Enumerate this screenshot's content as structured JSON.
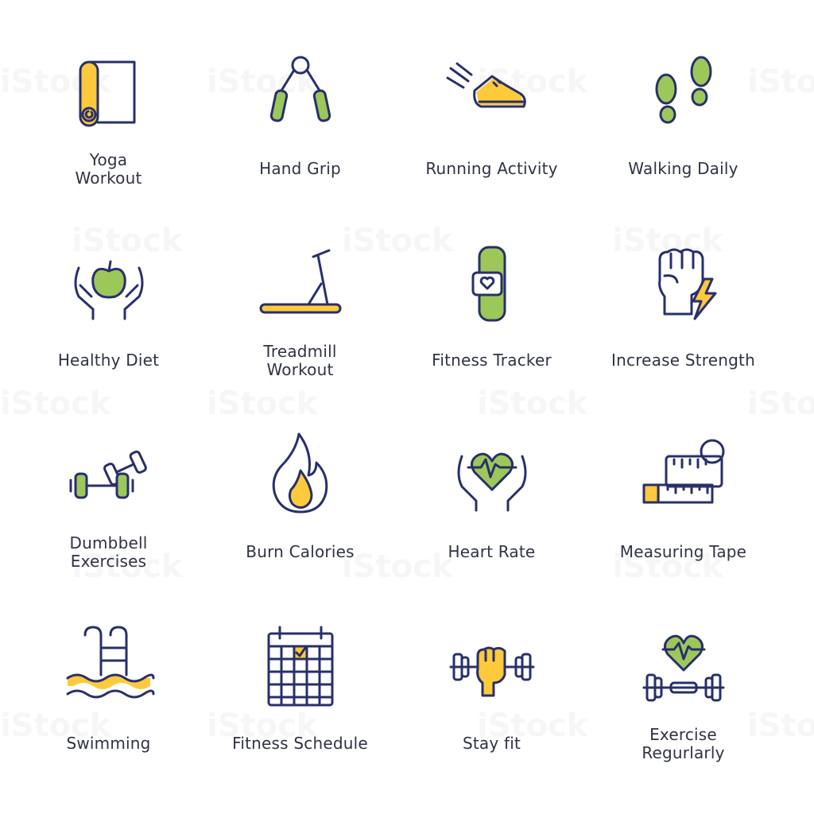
{
  "colors": {
    "stroke": "#27306b",
    "yellow": "#ffc93c",
    "green": "#9cc85a",
    "text": "#2f3344"
  },
  "watermark": "iStock",
  "icons": [
    {
      "label": "Yoga\nWorkout",
      "icon": "yoga-mat-icon"
    },
    {
      "label": "Hand Grip",
      "icon": "hand-grip-icon"
    },
    {
      "label": "Running Activity",
      "icon": "running-shoe-icon"
    },
    {
      "label": "Walking Daily",
      "icon": "footprints-icon"
    },
    {
      "label": "Healthy Diet",
      "icon": "hands-apple-icon"
    },
    {
      "label": "Treadmill\nWorkout",
      "icon": "treadmill-icon"
    },
    {
      "label": "Fitness Tracker",
      "icon": "fitness-band-icon"
    },
    {
      "label": "Increase Strength",
      "icon": "fist-lightning-icon"
    },
    {
      "label": "Dumbbell\nExercises",
      "icon": "dumbbells-icon"
    },
    {
      "label": "Burn Calories",
      "icon": "flame-icon"
    },
    {
      "label": "Heart Rate",
      "icon": "hands-heart-icon"
    },
    {
      "label": "Measuring Tape",
      "icon": "measuring-tape-icon"
    },
    {
      "label": "Swimming",
      "icon": "pool-ladder-icon"
    },
    {
      "label": "Fitness Schedule",
      "icon": "calendar-icon"
    },
    {
      "label": "Stay fit",
      "icon": "fist-barbell-icon"
    },
    {
      "label": "Exercise\nRegurlarly",
      "icon": "heart-dumbbell-icon"
    }
  ]
}
